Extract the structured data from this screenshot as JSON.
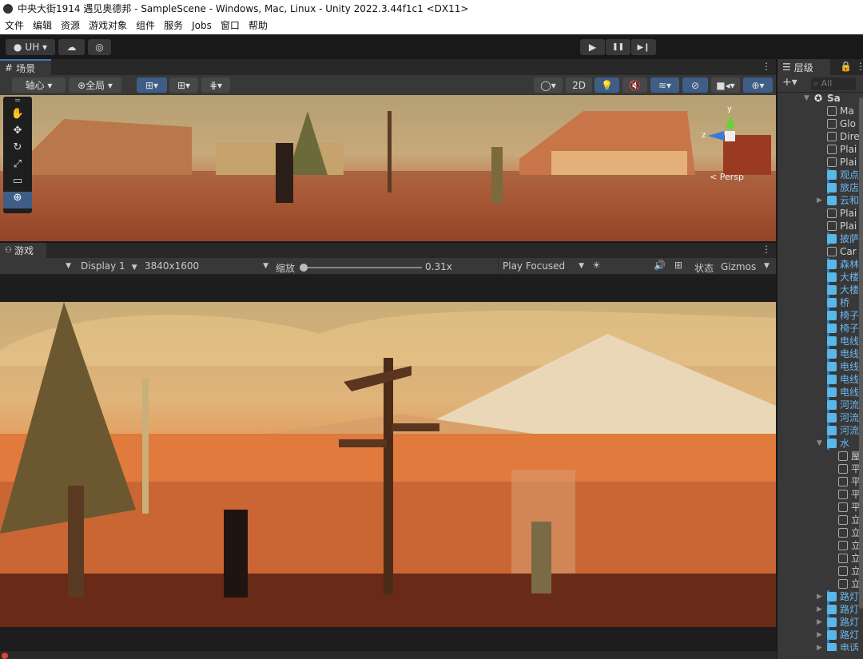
{
  "title": "中央大街1914 遇见奥德邦 - SampleScene - Windows, Mac, Linux - Unity 2022.3.44f1c1 <DX11>",
  "menu": [
    "文件",
    "编辑",
    "资源",
    "游戏对象",
    "组件",
    "服务",
    "Jobs",
    "窗口",
    "帮助"
  ],
  "toolbar": {
    "account": "UH ▾",
    "play": "▶",
    "pause": "❚❚",
    "step": "▶❙"
  },
  "scene": {
    "tab": "场景",
    "pivot": "轴心 ▾",
    "global": "全局 ▾",
    "mode_2d": "2D",
    "persp": "< Persp",
    "axis_y": "y",
    "axis_z": "z"
  },
  "game": {
    "tab": "游戏",
    "display": "Display 1",
    "resolution": "3840x1600",
    "scale_label": "缩放",
    "scale_value": "0.31x",
    "scale_fraction": 0.0,
    "play_mode": "Play Focused",
    "stats": "状态",
    "gizmos": "Gizmos"
  },
  "hierarchy": {
    "tab": "层级",
    "search_placeholder": "All",
    "add": "+▾",
    "items": [
      {
        "t": "Sa",
        "k": "scene",
        "d": 0,
        "exp": "open"
      },
      {
        "t": "Ma",
        "k": "go",
        "d": 1
      },
      {
        "t": "Glo",
        "k": "go",
        "d": 1
      },
      {
        "t": "Dire",
        "k": "go",
        "d": 1
      },
      {
        "t": "Plai",
        "k": "go",
        "d": 1
      },
      {
        "t": "Plai",
        "k": "go",
        "d": 1
      },
      {
        "t": "观点",
        "k": "pf",
        "d": 1,
        "m": 1
      },
      {
        "t": "旅店",
        "k": "pf",
        "d": 1,
        "m": 1
      },
      {
        "t": "云和",
        "k": "pf",
        "d": 1,
        "exp": "closed"
      },
      {
        "t": "Plai",
        "k": "go",
        "d": 1
      },
      {
        "t": "Plai",
        "k": "go",
        "d": 1
      },
      {
        "t": "披萨",
        "k": "pf",
        "d": 1,
        "m": 1
      },
      {
        "t": "Car",
        "k": "go",
        "d": 1
      },
      {
        "t": "森林",
        "k": "pf",
        "d": 1,
        "m": 1
      },
      {
        "t": "大楼",
        "k": "pf",
        "d": 1,
        "m": 1
      },
      {
        "t": "大楼",
        "k": "pf",
        "d": 1,
        "m": 1
      },
      {
        "t": "桥",
        "k": "pf",
        "d": 1,
        "m": 1
      },
      {
        "t": "椅子",
        "k": "pf",
        "d": 1,
        "m": 1
      },
      {
        "t": "椅子",
        "k": "pf",
        "d": 1,
        "m": 1
      },
      {
        "t": "电线",
        "k": "pf",
        "d": 1,
        "m": 1
      },
      {
        "t": "电线",
        "k": "pf",
        "d": 1,
        "m": 1
      },
      {
        "t": "电线",
        "k": "pf",
        "d": 1,
        "m": 1
      },
      {
        "t": "电线",
        "k": "pf",
        "d": 1,
        "m": 1
      },
      {
        "t": "电线",
        "k": "pf",
        "d": 1,
        "m": 1
      },
      {
        "t": "河流",
        "k": "pf",
        "d": 1,
        "m": 1
      },
      {
        "t": "河流",
        "k": "pf",
        "d": 1,
        "m": 1
      },
      {
        "t": "河流",
        "k": "pf",
        "d": 1,
        "m": 1
      },
      {
        "t": "水",
        "k": "pf",
        "d": 1,
        "exp": "open",
        "m": 1
      },
      {
        "t": "屋",
        "k": "go",
        "d": 2
      },
      {
        "t": "平",
        "k": "go",
        "d": 2
      },
      {
        "t": "平",
        "k": "go",
        "d": 2
      },
      {
        "t": "平",
        "k": "go",
        "d": 2
      },
      {
        "t": "平",
        "k": "go",
        "d": 2
      },
      {
        "t": "立",
        "k": "go",
        "d": 2
      },
      {
        "t": "立",
        "k": "go",
        "d": 2
      },
      {
        "t": "立",
        "k": "go",
        "d": 2
      },
      {
        "t": "立",
        "k": "go",
        "d": 2
      },
      {
        "t": "立",
        "k": "go",
        "d": 2
      },
      {
        "t": "立",
        "k": "go",
        "d": 2
      },
      {
        "t": "路灯",
        "k": "pf",
        "d": 1,
        "exp": "closed",
        "m": 1
      },
      {
        "t": "路灯",
        "k": "pf",
        "d": 1,
        "exp": "closed",
        "m": 1
      },
      {
        "t": "路灯",
        "k": "pf",
        "d": 1,
        "exp": "closed",
        "m": 1
      },
      {
        "t": "路灯",
        "k": "pf",
        "d": 1,
        "exp": "closed",
        "m": 1
      },
      {
        "t": "电话",
        "k": "pf",
        "d": 1,
        "exp": "closed",
        "m": 1
      }
    ]
  },
  "colors": {
    "accent": "#3f5e87",
    "prefab": "#5ab7ea",
    "panel": "#383838"
  }
}
